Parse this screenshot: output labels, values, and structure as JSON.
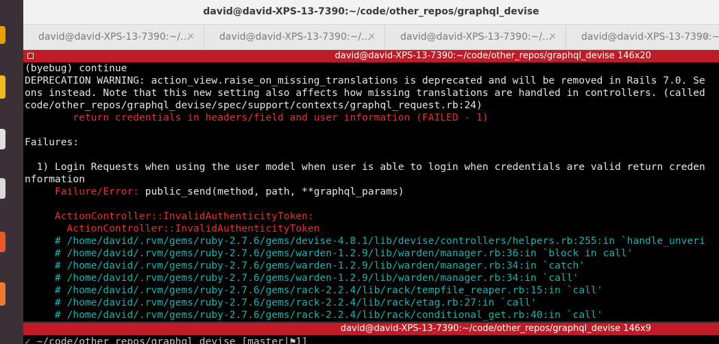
{
  "window": {
    "title": "david@david-XPS-13-7390:~/code/other_repos/graphql_devise"
  },
  "tabs": [
    {
      "label": "david@david-XPS-13-7390:~/…",
      "close": "×"
    },
    {
      "label": "david@david-XPS-13-7390:~/…",
      "close": "×"
    },
    {
      "label": "david@david-XPS-13-7390:~/…",
      "close": "×"
    },
    {
      "label": "david@david-XPS-13-7390:~/…",
      "close": "×"
    }
  ],
  "pane_top": {
    "title": "david@david-XPS-13-7390:~/code/other_repos/graphql_devise 146x20"
  },
  "pane_bottom": {
    "title": "david@david-XPS-13-7390:~/code/other_repos/graphql_devise 146x9"
  },
  "terminal_lines": [
    {
      "text": "(byebug) continue",
      "color": "w"
    },
    {
      "text": "DEPRECATION WARNING: action_view.raise_on_missing_translations is deprecated and will be removed in Rails 7.0. Se",
      "color": "w"
    },
    {
      "text": "ons instead. Note that this new setting also affects how missing translations are handled in controllers. (called",
      "color": "w"
    },
    {
      "text": "code/other_repos/graphql_devise/spec/support/contexts/graphql_request.rb:24)",
      "color": "w"
    },
    {
      "text": "        return credentials in headers/field and user information (FAILED - 1)",
      "color": "r"
    },
    {
      "text": "",
      "color": "w"
    },
    {
      "text": "Failures:",
      "color": "w"
    },
    {
      "text": "",
      "color": "w"
    },
    {
      "text": "  1) Login Requests when using the user model when user is able to login when credentials are valid return creden",
      "color": "w"
    },
    {
      "text": "nformation",
      "color": "w"
    },
    {
      "text": "     Failure/Error: ",
      "color": "r",
      "rest": "public_send(method, path, **graphql_params)",
      "rest_color": "w"
    },
    {
      "text": "",
      "color": "w"
    },
    {
      "text": "     ActionController::InvalidAuthenticityToken:",
      "color": "r"
    },
    {
      "text": "       ActionController::InvalidAuthenticityToken",
      "color": "r"
    },
    {
      "text": "     # /home/david/.rvm/gems/ruby-2.7.6/gems/devise-4.8.1/lib/devise/controllers/helpers.rb:255:in `handle_unveri",
      "color": "c"
    },
    {
      "text": "     # /home/david/.rvm/gems/ruby-2.7.6/gems/warden-1.2.9/lib/warden/manager.rb:36:in `block in call'",
      "color": "c"
    },
    {
      "text": "     # /home/david/.rvm/gems/ruby-2.7.6/gems/warden-1.2.9/lib/warden/manager.rb:34:in `catch'",
      "color": "c"
    },
    {
      "text": "     # /home/david/.rvm/gems/ruby-2.7.6/gems/warden-1.2.9/lib/warden/manager.rb:34:in `call'",
      "color": "c"
    },
    {
      "text": "     # /home/david/.rvm/gems/ruby-2.7.6/gems/rack-2.2.4/lib/rack/tempfile_reaper.rb:15:in `call'",
      "color": "c"
    },
    {
      "text": "     # /home/david/.rvm/gems/ruby-2.7.6/gems/rack-2.2.4/lib/rack/etag.rb:27:in `call'",
      "color": "c"
    },
    {
      "text": "     # /home/david/.rvm/gems/ruby-2.7.6/gems/rack-2.2.4/lib/rack/conditional_get.rb:40:in `call'",
      "color": "c"
    }
  ],
  "prompt": {
    "check": "✓",
    "text": " ~/code/other_repos/graphql_devise [master|⚑1]"
  },
  "colors": {
    "pane_header": "#c01c28",
    "error_red": "#e8312f",
    "trace_cyan": "#19b3b3"
  }
}
